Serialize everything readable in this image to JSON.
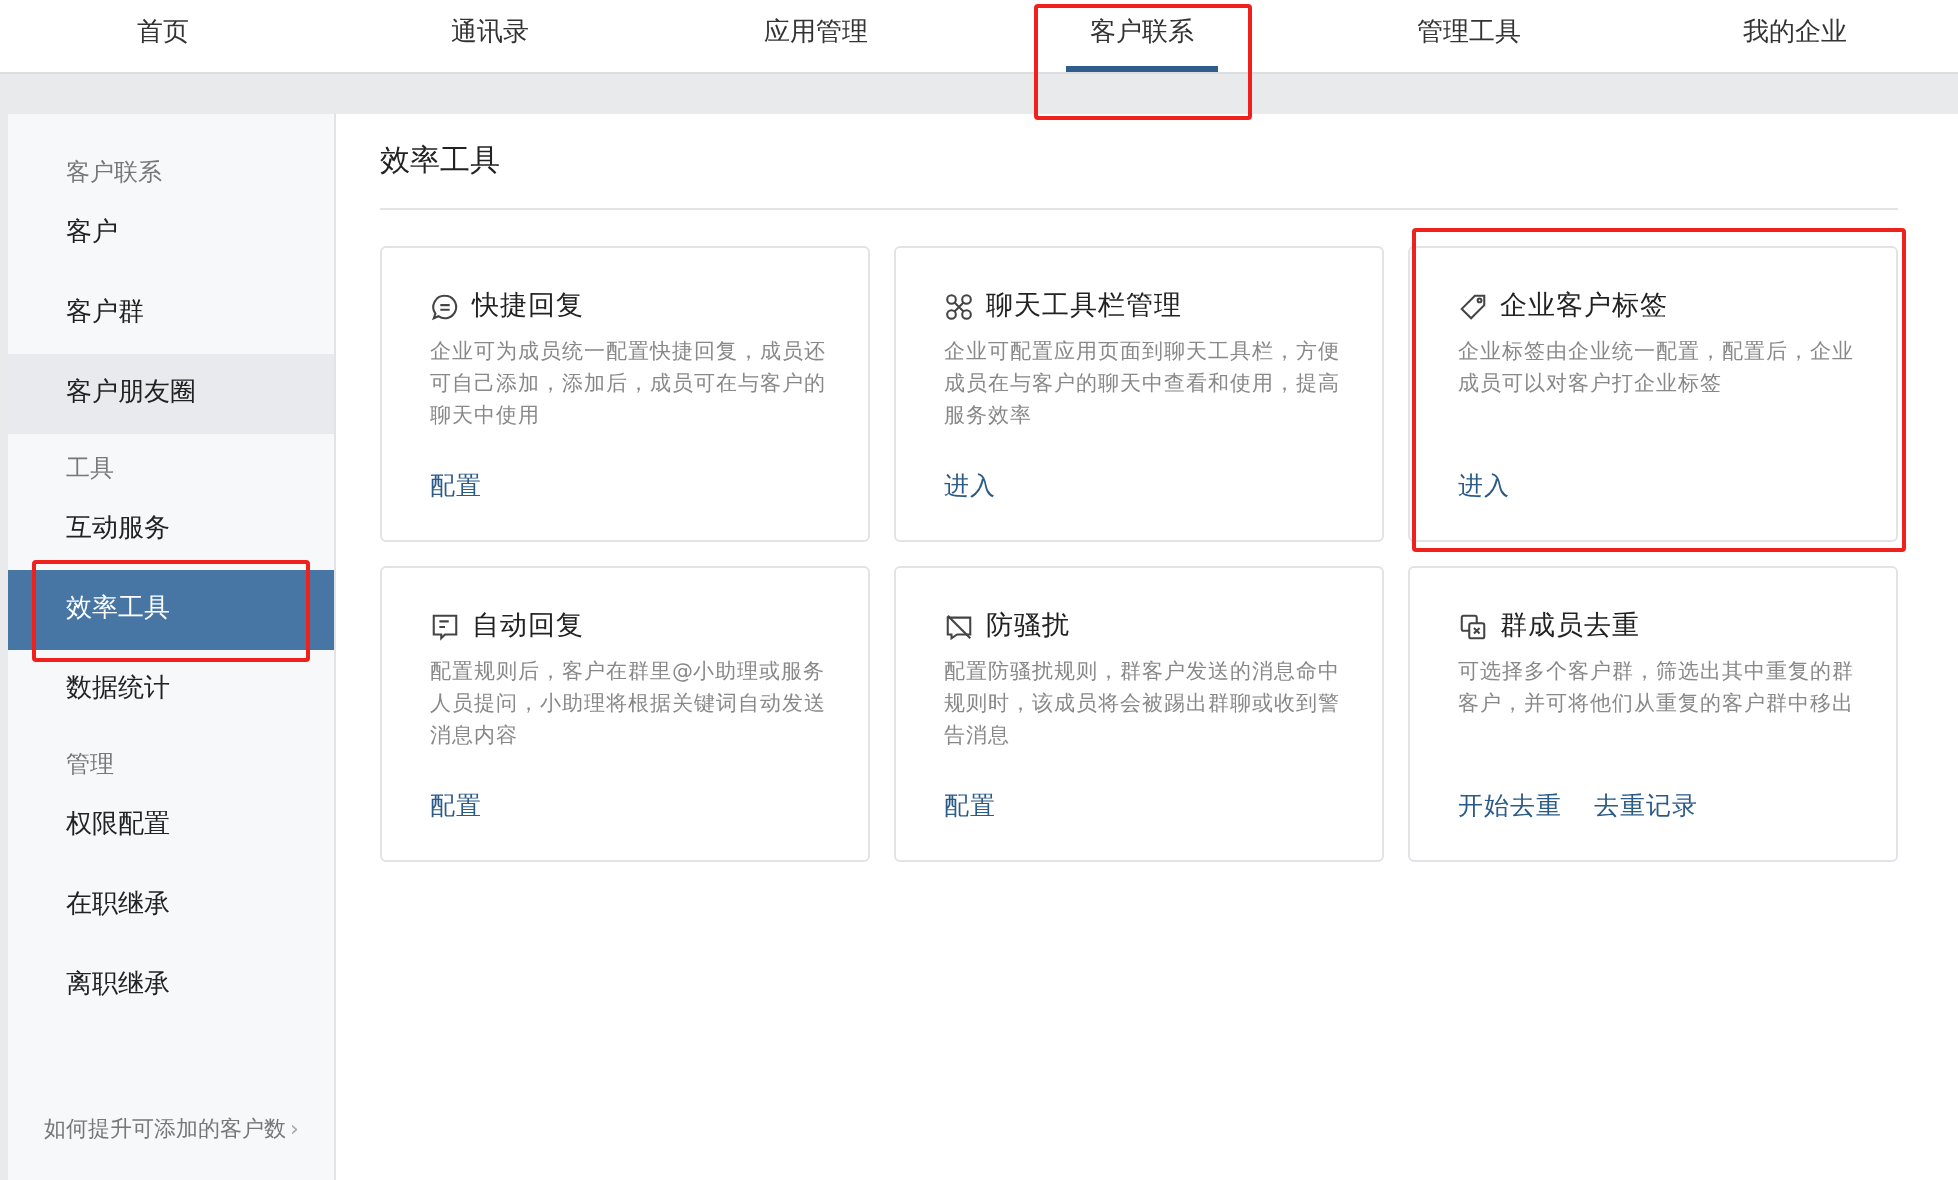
{
  "nav": {
    "tabs": [
      {
        "label": "首页",
        "selected": false,
        "highlighted": false
      },
      {
        "label": "通讯录",
        "selected": false,
        "highlighted": false
      },
      {
        "label": "应用管理",
        "selected": false,
        "highlighted": false
      },
      {
        "label": "客户联系",
        "selected": true,
        "highlighted": true
      },
      {
        "label": "管理工具",
        "selected": false,
        "highlighted": false
      },
      {
        "label": "我的企业",
        "selected": false,
        "highlighted": false
      }
    ]
  },
  "sidebar": {
    "groups": [
      {
        "title": "客户联系",
        "items": [
          {
            "label": "客户",
            "selected": false,
            "hovered": false,
            "highlighted": false
          },
          {
            "label": "客户群",
            "selected": false,
            "hovered": false,
            "highlighted": false
          },
          {
            "label": "客户朋友圈",
            "selected": false,
            "hovered": true,
            "highlighted": false
          }
        ]
      },
      {
        "title": "工具",
        "items": [
          {
            "label": "互动服务",
            "selected": false,
            "hovered": false,
            "highlighted": false
          },
          {
            "label": "效率工具",
            "selected": true,
            "hovered": false,
            "highlighted": true
          },
          {
            "label": "数据统计",
            "selected": false,
            "hovered": false,
            "highlighted": false
          }
        ]
      },
      {
        "title": "管理",
        "items": [
          {
            "label": "权限配置",
            "selected": false,
            "hovered": false,
            "highlighted": false
          },
          {
            "label": "在职继承",
            "selected": false,
            "hovered": false,
            "highlighted": false
          },
          {
            "label": "离职继承",
            "selected": false,
            "hovered": false,
            "highlighted": false
          }
        ]
      }
    ],
    "footer_link": "如何提升可添加的客户数",
    "footer_arrow": "›"
  },
  "content": {
    "title": "效率工具",
    "cards": [
      {
        "kind": "reply",
        "title": "快捷回复",
        "description": "企业可为成员统一配置快捷回复，成员还可自己添加，添加后，成员可在与客户的聊天中使用",
        "links": [
          "配置"
        ],
        "highlighted": false
      },
      {
        "kind": "toolbar",
        "title": "聊天工具栏管理",
        "description": "企业可配置应用页面到聊天工具栏，方便成员在与客户的聊天中查看和使用，提高服务效率",
        "links": [
          "进入"
        ],
        "highlighted": false
      },
      {
        "kind": "tag",
        "title": "企业客户标签",
        "description": "企业标签由企业统一配置，配置后，企业成员可以对客户打企业标签",
        "links": [
          "进入"
        ],
        "highlighted": true
      },
      {
        "kind": "auto",
        "title": "自动回复",
        "description": "配置规则后，客户在群里@小助理或服务人员提问，小助理将根据关键词自动发送消息内容",
        "links": [
          "配置"
        ],
        "highlighted": false
      },
      {
        "kind": "block",
        "title": "防骚扰",
        "description": "配置防骚扰规则，群客户发送的消息命中规则时，该成员将会被踢出群聊或收到警告消息",
        "links": [
          "配置"
        ],
        "highlighted": false
      },
      {
        "kind": "dedupe",
        "title": "群成员去重",
        "description": "可选择多个客户群，筛选出其中重复的群客户，并可将他们从重复的客户群中移出",
        "links": [
          "开始去重",
          "去重记录"
        ],
        "highlighted": false
      }
    ]
  }
}
